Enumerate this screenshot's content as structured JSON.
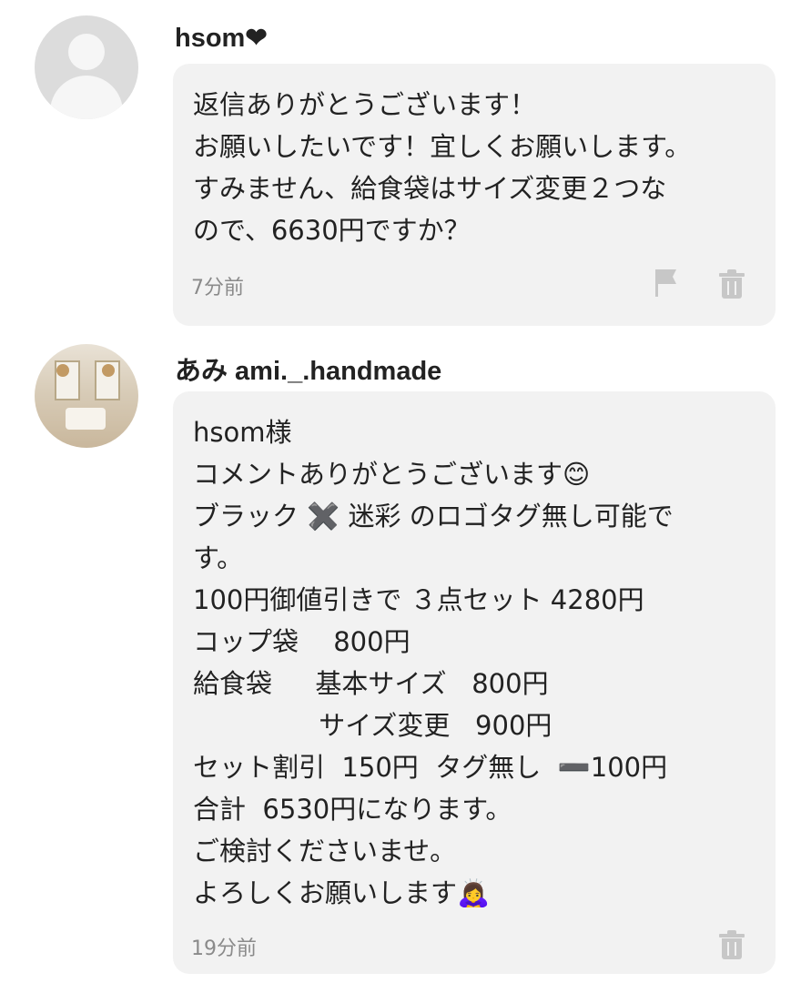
{
  "comments": [
    {
      "username": "hsom❤",
      "lines": [
        "返信ありがとうございます！",
        "お願いしたいです！宜しくお願いします。",
        "すみません、給食袋はサイズ変更２つな",
        "ので、6630円ですか？"
      ],
      "time": "7分前",
      "avatar": "default-user-icon",
      "actions": [
        "flag-icon",
        "trash-icon"
      ]
    },
    {
      "username": "あみ  ami._.handmade",
      "lines": [
        "hsom様",
        "コメントありがとうございます😊",
        "ブラック ✖️ 迷彩 のロゴタグ無し可能で",
        "す。",
        "100円御値引きで ３点セット 4280円",
        "コップ袋　 800円",
        "給食袋　  基本サイズ   800円",
        "               サイズ変更   900円",
        "セット割引  150円  タグ無し  ➖100円",
        "合計  6530円になります。",
        "ご検討くださいませ。",
        "よろしくお願いします🙇‍♀️"
      ],
      "time": "19分前",
      "avatar": "profile-photo",
      "actions": [
        "trash-icon"
      ]
    }
  ],
  "colors": {
    "bubble": "#f2f2f2",
    "timestamp": "#8a8a8a",
    "icon": "#c7c7c7"
  }
}
